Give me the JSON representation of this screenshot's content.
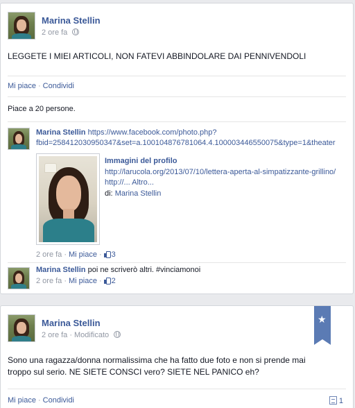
{
  "post1": {
    "author": "Marina Stellin",
    "time": "2 ore fa",
    "text": "LEGGETE I MIEI ARTICOLI, NON FATEVI ABBINDOLARE DAI PENNIVENDOLI",
    "actions": {
      "like": "Mi piace",
      "share": "Condividi"
    },
    "likes": "Piace a 20 persone.",
    "comments": [
      {
        "author": "Marina Stellin",
        "text_line1": "https://www.facebook.com/photo.php?",
        "text_line2": "fbid=258412030950347&set=a.100104876781064.4.100003446550075&type=1&theater",
        "attachment": {
          "title": "Immagini del profilo",
          "url_line1": "http://larucola.org/2013/07/10/lettera-aperta-al-simpatizzante-grillino/",
          "url_line2": "http://... Altro...",
          "by_prefix": "di: ",
          "by_name": "Marina Stellin"
        },
        "time": "2 ore fa",
        "like": "Mi piace",
        "like_count": "3"
      },
      {
        "author": "Marina Stellin",
        "text": "poi ne scriverò altri. #vinciamonoi",
        "time": "2 ore fa",
        "like": "Mi piace",
        "like_count": "2"
      }
    ]
  },
  "post2": {
    "author": "Marina Stellin",
    "time": "2 ore fa",
    "edited": "Modificato",
    "text_line1": "Sono una ragazza/donna normalissima che ha fatto due foto e non si prende mai",
    "text_line2": "troppo sul serio. NE SIETE CONSCI vero? SIETE NEL PANICO eh?",
    "actions": {
      "like": "Mi piace",
      "share": "Condividi"
    },
    "comment_count": "1"
  },
  "separator": "·",
  "icons": {
    "privacy": "globe-icon",
    "like": "thumbs-up-icon",
    "highlight": "star-ribbon-icon",
    "comments": "comment-icon"
  },
  "colors": {
    "link": "#3b5998",
    "muted": "#9197a3",
    "background": "#e9eaed",
    "ribbon": "#5b7bb4"
  }
}
